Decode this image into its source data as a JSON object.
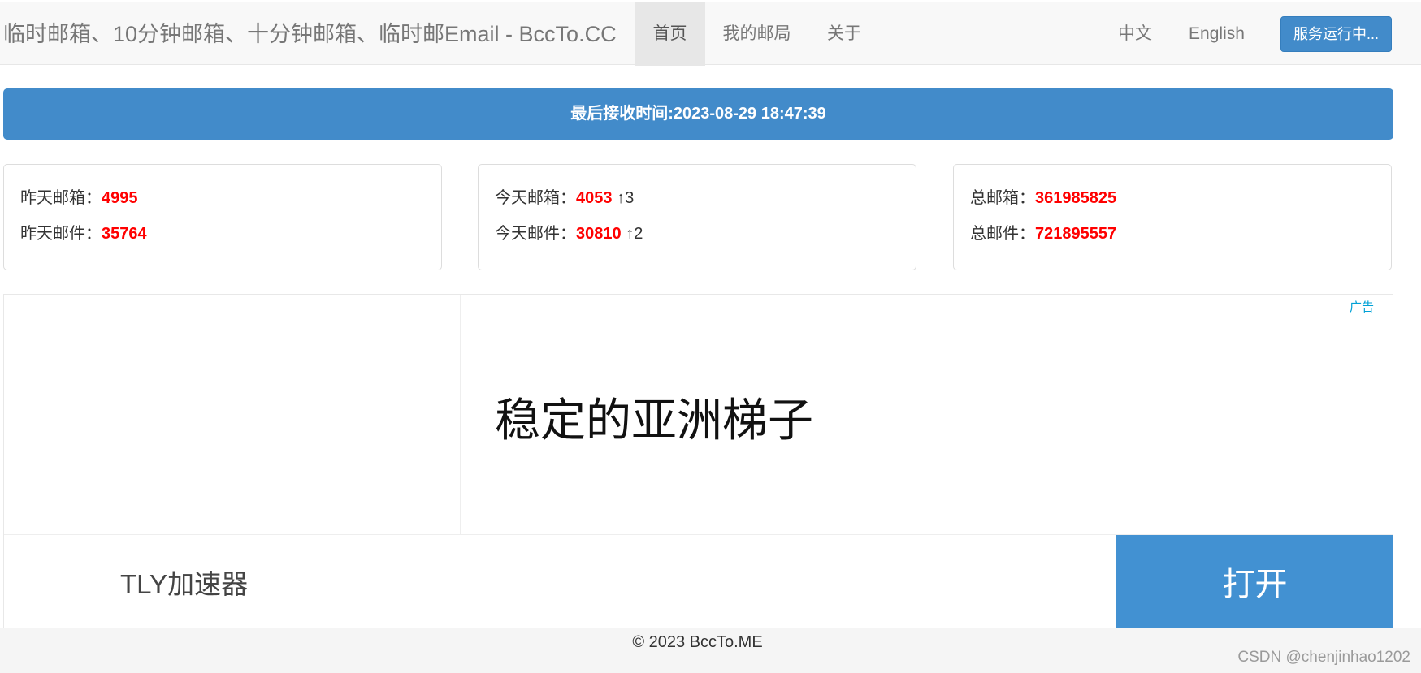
{
  "navbar": {
    "brand": "临时邮箱、10分钟邮箱、十分钟邮箱、临时邮Email - BccTo.CC",
    "items": [
      {
        "label": "首页",
        "active": true
      },
      {
        "label": "我的邮局",
        "active": false
      },
      {
        "label": "关于",
        "active": false
      }
    ],
    "languages": [
      "中文",
      "English"
    ],
    "status_button": "服务运行中..."
  },
  "alert": {
    "text": "最后接收时间:2023-08-29 18:47:39"
  },
  "stats": {
    "yesterday": {
      "mailbox_label": "昨天邮箱：",
      "mailbox_value": "4995",
      "mail_label": "昨天邮件：",
      "mail_value": "35764"
    },
    "today": {
      "mailbox_label": "今天邮箱：",
      "mailbox_value": "4053",
      "mailbox_delta": "↑3",
      "mail_label": "今天邮件：",
      "mail_value": "30810",
      "mail_delta": "↑2"
    },
    "total": {
      "mailbox_label": "总邮箱：",
      "mailbox_value": "361985825",
      "mail_label": "总邮件：",
      "mail_value": "721895557"
    },
    "colors": {
      "number": "#ff0000"
    }
  },
  "ad": {
    "label": "广告",
    "headline": "稳定的亚洲梯子",
    "name": "TLY加速器",
    "open_button": "打开",
    "colors": {
      "button": "#4291d2",
      "label": "#00a1d6"
    }
  },
  "footer": {
    "copyright": "© 2023 BccTo.ME",
    "watermark": "CSDN @chenjinhao1202"
  },
  "colors": {
    "primary": "#428bca",
    "navbar_bg": "#f8f8f8"
  }
}
